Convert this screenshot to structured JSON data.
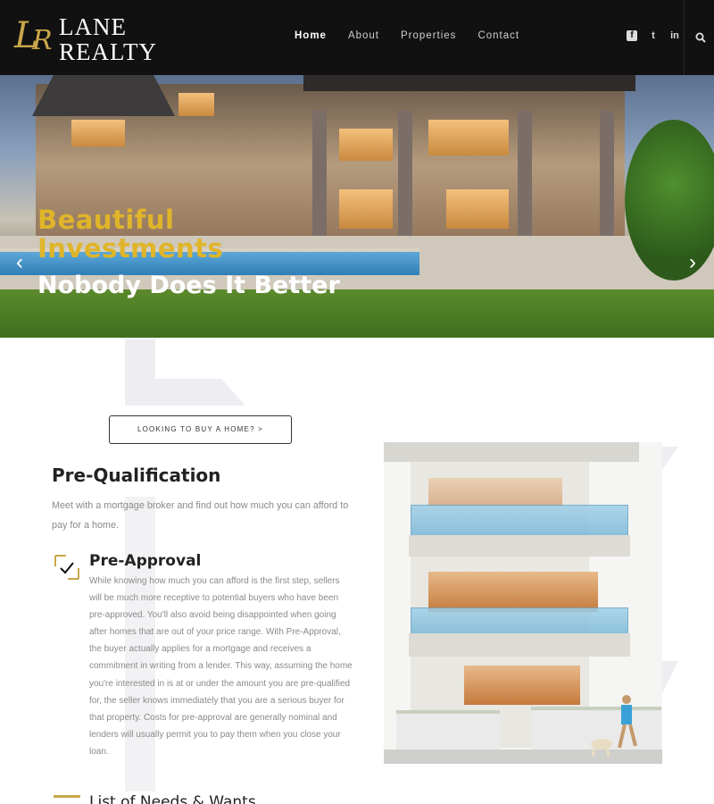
{
  "header": {
    "logo": {
      "monogram_1": "L",
      "monogram_2": "R",
      "word_1": "LANE",
      "word_2": "REALTY"
    },
    "nav": [
      {
        "label": "Home",
        "active": true
      },
      {
        "label": "About"
      },
      {
        "label": "Properties"
      },
      {
        "label": "Contact"
      }
    ],
    "social": [
      {
        "icon": "facebook-icon",
        "label": "f"
      },
      {
        "icon": "twitter-icon",
        "label": "t"
      },
      {
        "icon": "linkedin-icon",
        "label": "in"
      }
    ]
  },
  "hero": {
    "title_gold_1": "Beautiful",
    "title_gold_2": "Investments",
    "title_white": "Nobody Does It Better",
    "prev_arrow": "‹",
    "next_arrow": "›"
  },
  "main": {
    "cta_label": "LOOKING TO BUY A HOME? >",
    "section_title": "Pre-Qualification",
    "section_text": "Meet with a mortgage broker and find out how much you can afford to pay for a home.",
    "item_title": "Pre-Approval",
    "item_text": "While knowing how much you can afford is the first step, sellers will be much more receptive to potential buyers who have been pre-approved. You'll also avoid being disappointed when going after homes that are out of your price range. With Pre-Approval, the buyer actually applies for a mortgage and receives a commitment in writing from a lender. This way, assuming the home you're interested in is at or under the amount you are pre-qualified for, the seller knows immediately that you are a serious buyer for that property. Costs for pre-approval are generally nominal and lenders will usually permit you to pay them when you close your loan.",
    "next_item_title": "List of Needs & Wants"
  },
  "colors": {
    "gold": "#e0b52a",
    "header_bg": "#111111",
    "muted_text": "#8a8a8a"
  }
}
